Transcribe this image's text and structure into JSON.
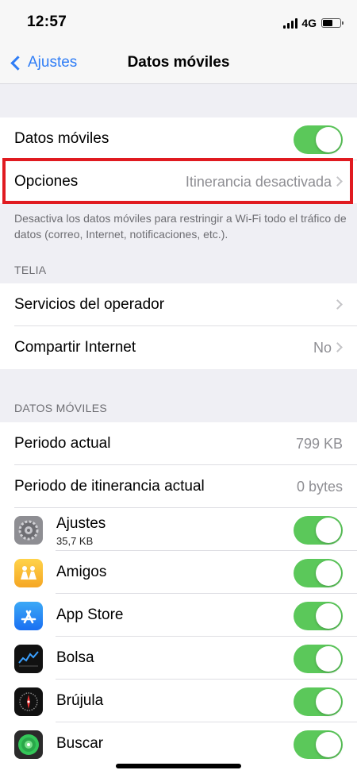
{
  "status": {
    "time": "12:57",
    "network": "4G"
  },
  "nav": {
    "back_label": "Ajustes",
    "title": "Datos móviles"
  },
  "main_group": {
    "mobile_data_label": "Datos móviles",
    "mobile_data_on": true,
    "options_label": "Opciones",
    "options_value": "Itinerancia desactivada"
  },
  "footer_note": "Desactiva los datos móviles para restringir a Wi-Fi todo el tráfico de datos (correo, Internet, notificaciones, etc.).",
  "carrier_section": {
    "header": "TELIA",
    "services_label": "Servicios del operador",
    "hotspot_label": "Compartir Internet",
    "hotspot_value": "No"
  },
  "usage_section": {
    "header": "DATOS MÓVILES",
    "current_period_label": "Periodo actual",
    "current_period_value": "799 KB",
    "roaming_period_label": "Periodo de itinerancia actual",
    "roaming_period_value": "0 bytes"
  },
  "apps": [
    {
      "name": "Ajustes",
      "usage": "35,7 KB",
      "icon": "settings-gear",
      "enabled": true
    },
    {
      "name": "Amigos",
      "usage": "",
      "icon": "friends-people",
      "enabled": true
    },
    {
      "name": "App Store",
      "usage": "",
      "icon": "app-store-a",
      "enabled": true
    },
    {
      "name": "Bolsa",
      "usage": "",
      "icon": "stocks-chart",
      "enabled": true
    },
    {
      "name": "Brújula",
      "usage": "",
      "icon": "compass",
      "enabled": true
    },
    {
      "name": "Buscar",
      "usage": "",
      "icon": "find-my-radar",
      "enabled": true
    }
  ],
  "colors": {
    "accent": "#2f7df6",
    "toggle_on": "#5bc85a",
    "highlight": "#e01a20"
  }
}
